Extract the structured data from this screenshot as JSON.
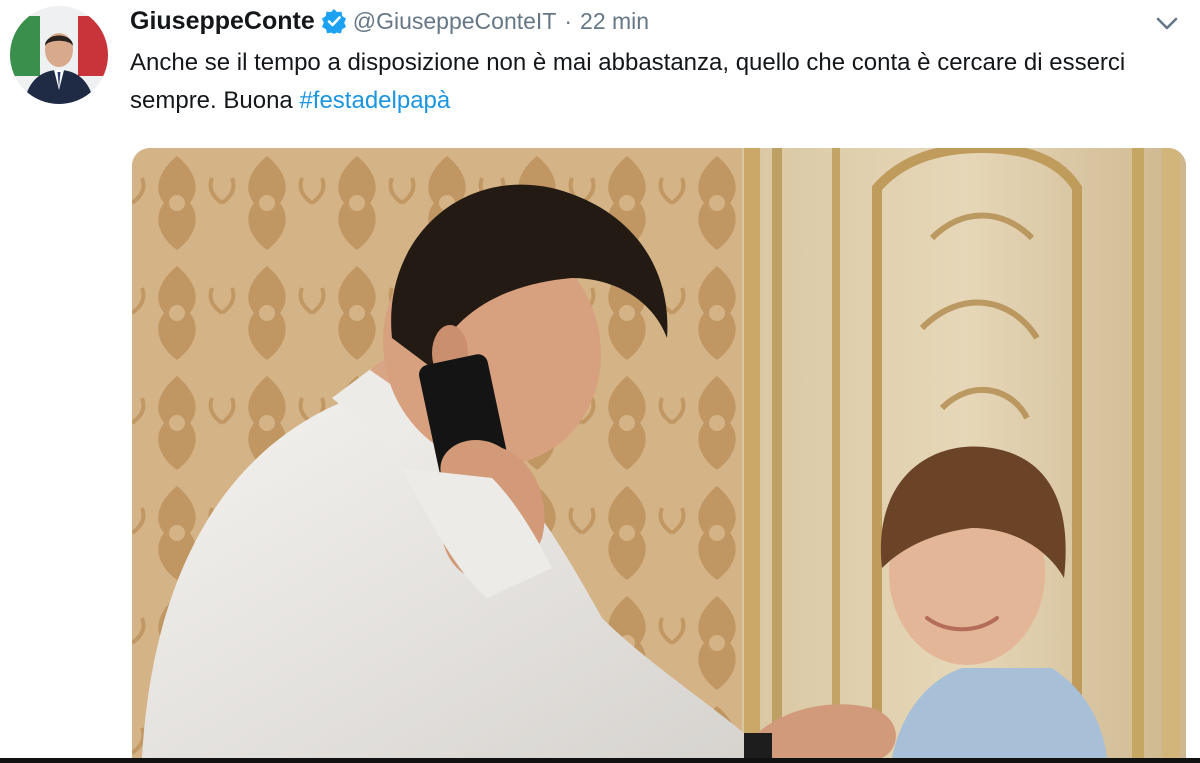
{
  "tweet": {
    "display_name": "GiuseppeConte",
    "verified": true,
    "handle": "@GiuseppeConteIT",
    "separator": "·",
    "time": "22 min",
    "text_before": "Anche se il tempo a disposizione non è mai abbastanza, quello che conta è cercare di esserci sempre. Buona ",
    "hashtag": "#festadelpapà",
    "avatar": {
      "icon": "profile-photo-icon"
    },
    "menu": {
      "icon": "chevron-down-icon"
    },
    "media": {
      "description_icon": "photo-image"
    }
  },
  "colors": {
    "text": "#14171a",
    "secondary": "#657786",
    "link": "#1b95e0",
    "verified": "#1da1f2"
  }
}
